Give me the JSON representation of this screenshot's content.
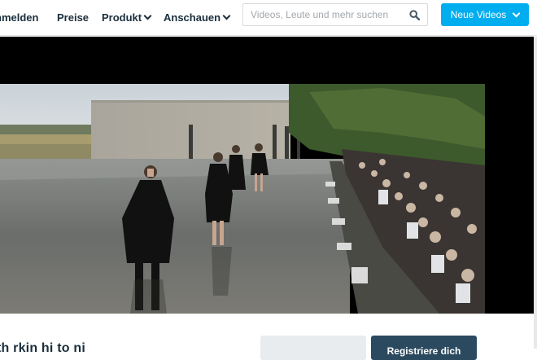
{
  "nav": {
    "login": "nmelden",
    "prices": "Preise",
    "product": "Produkt",
    "watch": "Anschauen"
  },
  "search": {
    "placeholder": "Videos, Leute und mehr suchen",
    "icon": "search-icon"
  },
  "new_videos_button": "Neue Videos",
  "below_video": {
    "text": "th    rkin   hi    to      ni",
    "register_button": "Registriere dich",
    "light_button": ""
  },
  "colors": {
    "accent": "#00adef",
    "dark_button": "#2c4a5f",
    "nav_text": "#1a2e3b"
  }
}
